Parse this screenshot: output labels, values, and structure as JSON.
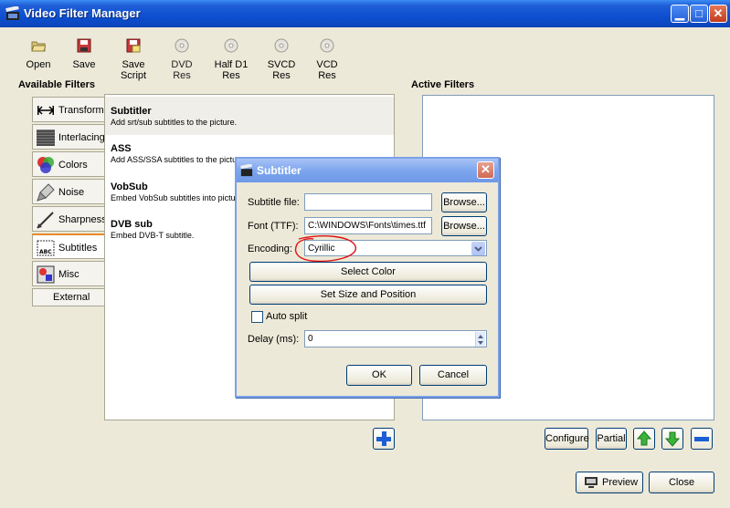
{
  "window": {
    "title": "Video Filter Manager"
  },
  "toolbar": [
    {
      "label": "Open",
      "icon": "open-folder-icon"
    },
    {
      "label": "Save",
      "icon": "save-disk-icon"
    },
    {
      "label": "Save Script",
      "icon": "save-script-icon"
    },
    {
      "label": "DVD Res",
      "icon": "disc-icon"
    },
    {
      "label": "Half D1 Res",
      "icon": "disc-icon"
    },
    {
      "label": "SVCD Res",
      "icon": "disc-icon"
    },
    {
      "label": "VCD Res",
      "icon": "disc-icon"
    }
  ],
  "available": {
    "label": "Available Filters",
    "categories": [
      {
        "label": "Transform",
        "icon": "transform-icon"
      },
      {
        "label": "Interlacing",
        "icon": "interlacing-icon"
      },
      {
        "label": "Colors",
        "icon": "colors-icon"
      },
      {
        "label": "Noise",
        "icon": "noise-icon"
      },
      {
        "label": "Sharpness",
        "icon": "sharpness-icon"
      },
      {
        "label": "Subtitles",
        "icon": "subtitles-icon",
        "selected": true
      },
      {
        "label": "Misc",
        "icon": "misc-icon"
      },
      {
        "label": "External",
        "icon": ""
      }
    ],
    "filters": [
      {
        "name": "Subtitler",
        "desc": "Add srt/sub subtitles to the picture.",
        "selected": true
      },
      {
        "name": "ASS",
        "desc": "Add ASS/SSA subtitles to the picture."
      },
      {
        "name": "VobSub",
        "desc": "Embed VobSub subtitles into picture."
      },
      {
        "name": "DVB sub",
        "desc": "Embed DVB-T subtitle."
      }
    ]
  },
  "active": {
    "label": "Active Filters"
  },
  "buttons": {
    "configure": "Configure",
    "partial": "Partial",
    "preview": "Preview",
    "close": "Close"
  },
  "dialog": {
    "title": "Subtitler",
    "subtitle_file_label": "Subtitle file:",
    "subtitle_file_value": "",
    "font_label": "Font (TTF):",
    "font_value": "C:\\WINDOWS\\Fonts\\times.ttf",
    "browse": "Browse...",
    "encoding_label": "Encoding:",
    "encoding_value": "Cyrillic",
    "select_color": "Select Color",
    "set_size": "Set Size and Position",
    "auto_split": "Auto split",
    "delay_label": "Delay (ms):",
    "delay_value": "0",
    "ok": "OK",
    "cancel": "Cancel",
    "annotation_color": "#e01010"
  }
}
